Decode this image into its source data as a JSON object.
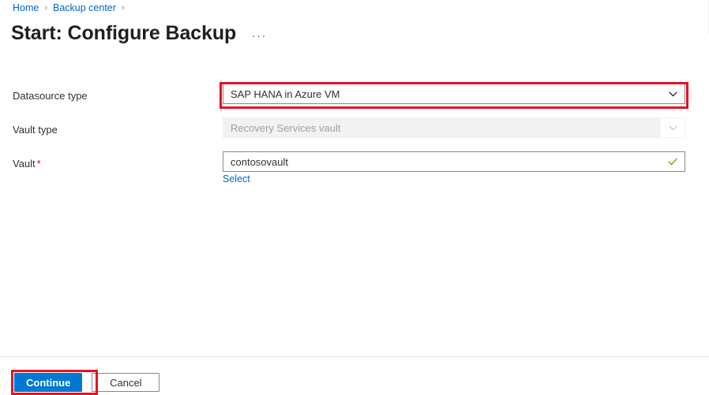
{
  "breadcrumb": {
    "items": [
      {
        "label": "Home"
      },
      {
        "label": "Backup center"
      }
    ],
    "separator": "›"
  },
  "header": {
    "title": "Start: Configure Backup",
    "more_label": "···"
  },
  "form": {
    "fields": [
      {
        "label": "Datasource type",
        "required": false,
        "value": "SAP HANA in Azure VM",
        "control": "dropdown",
        "state": "enabled",
        "icon": "chevron-down-icon"
      },
      {
        "label": "Vault type",
        "required": false,
        "value": "Recovery Services vault",
        "control": "dropdown",
        "state": "disabled",
        "icon": "chevron-down-icon"
      },
      {
        "label": "Vault",
        "required": true,
        "required_marker": "*",
        "value": "contosovault",
        "control": "textbox",
        "state": "valid",
        "icon": "checkmark-icon",
        "sublink": "Select"
      }
    ]
  },
  "footer": {
    "continue_label": "Continue",
    "cancel_label": "Cancel"
  },
  "annotations": [
    {
      "name": "datasource-type-highlight",
      "color": "#e81123"
    },
    {
      "name": "continue-button-highlight",
      "color": "#e81123"
    }
  ],
  "colors": {
    "accent": "#0078d4",
    "link": "#0068c8",
    "required": "#a4262c",
    "valid": "#6bb700",
    "annotation": "#e81123",
    "disabled_bg": "#f3f2f1",
    "border": "#8a8886"
  }
}
